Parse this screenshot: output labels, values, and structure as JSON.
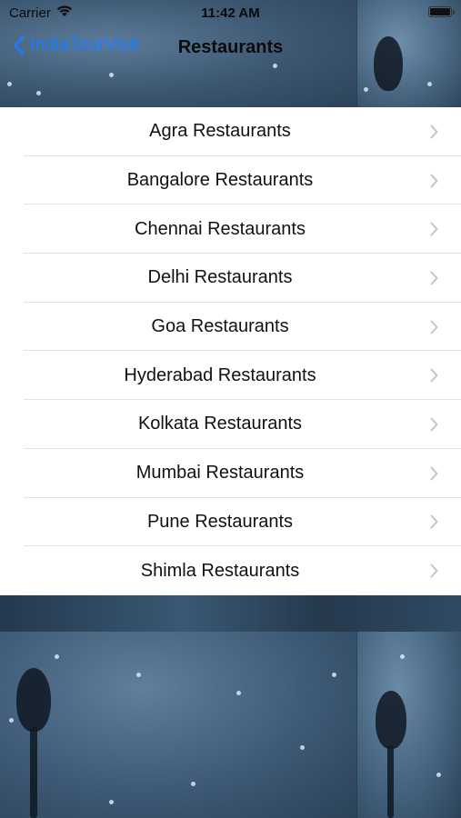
{
  "status_bar": {
    "carrier": "Carrier",
    "time": "11:42 AM"
  },
  "nav": {
    "back_label": "IndiaTourVisit",
    "title": "Restaurants"
  },
  "list": {
    "items": [
      {
        "label": "Agra Restaurants"
      },
      {
        "label": "Bangalore Restaurants"
      },
      {
        "label": "Chennai Restaurants"
      },
      {
        "label": "Delhi Restaurants"
      },
      {
        "label": "Goa Restaurants"
      },
      {
        "label": "Hyderabad Restaurants"
      },
      {
        "label": "Kolkata Restaurants"
      },
      {
        "label": "Mumbai Restaurants"
      },
      {
        "label": "Pune Restaurants"
      },
      {
        "label": "Shimla Restaurants"
      }
    ]
  },
  "colors": {
    "accent": "#1a7cff",
    "list_bg": "#ffffff",
    "chevron": "#c4c4c7"
  }
}
